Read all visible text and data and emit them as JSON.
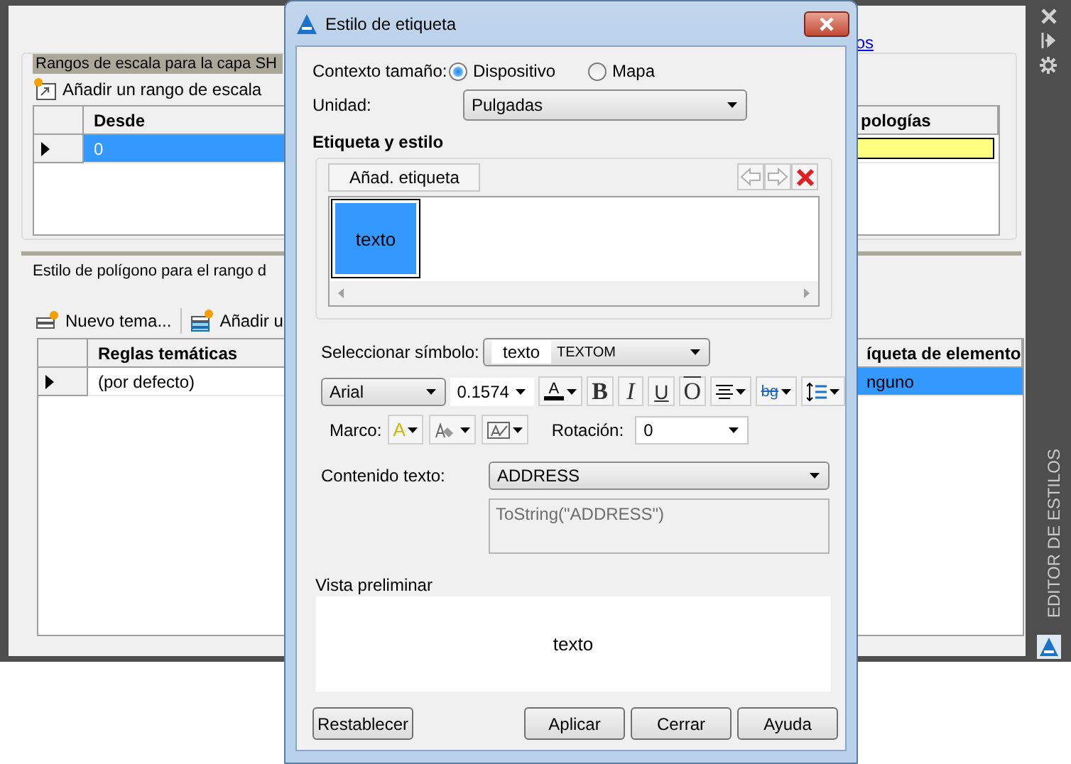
{
  "palette": {
    "link": "os",
    "title": "EDITOR DE ESTILOS",
    "scale_ranges": {
      "title": "Rangos de escala para la capa SH",
      "add_button": "Añadir un rango de escala",
      "columns": [
        "Desde",
        "pologías"
      ],
      "rows": [
        {
          "from": "0",
          "selected": true
        }
      ]
    },
    "polygon_style": {
      "title": "Estilo de polígono para el rango d",
      "toolbar": [
        "Nuevo tema...",
        "Añadir u"
      ],
      "columns": [
        "Reglas temáticas",
        "íqueta de elemento"
      ],
      "rows": [
        {
          "rule": "(por defecto)",
          "label": "nguno",
          "selected": true
        }
      ]
    }
  },
  "dialog": {
    "title": "Estilo de etiqueta",
    "size_context": {
      "label": "Contexto tamaño:",
      "options": [
        {
          "label": "Dispositivo",
          "selected": true
        },
        {
          "label": "Mapa",
          "selected": false
        }
      ]
    },
    "unit": {
      "label": "Unidad:",
      "value": "Pulgadas"
    },
    "section": "Etiqueta y estilo",
    "add_label_button": "Añad. etiqueta",
    "labels": [
      {
        "text": "texto",
        "selected": true
      }
    ],
    "symbol": {
      "label": "Seleccionar símbolo:",
      "preview": "texto",
      "value": "TEXTOM"
    },
    "format": {
      "font": "Arial",
      "size": "0.1574",
      "color_glyph": "A",
      "styles": [
        "B",
        "I",
        "U",
        "O"
      ],
      "background_glyph": "bg"
    },
    "frame": {
      "label": "Marco:",
      "glyph": "A"
    },
    "rotation": {
      "label": "Rotación:",
      "value": "0"
    },
    "content": {
      "label": "Contenido texto:",
      "value": "ADDRESS",
      "expression": "ToString(\"ADDRESS\")"
    },
    "preview": {
      "label": "Vista preliminar",
      "text": "texto"
    },
    "buttons": [
      "Restablecer",
      "Aplicar",
      "Cerrar",
      "Ayuda"
    ]
  }
}
